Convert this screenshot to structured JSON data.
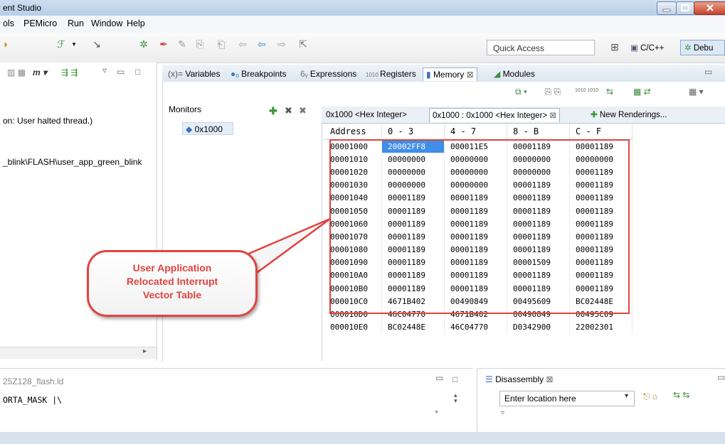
{
  "window": {
    "title": "ent Studio"
  },
  "menu": [
    "ols",
    "PEMicro",
    "Run",
    "Window",
    "Help"
  ],
  "toolbar": {
    "quick_access": "Quick Access",
    "perspective_cc": "C/C++",
    "perspective_debug": "Debu"
  },
  "left_panel": {
    "line1": "on: User halted thread.)",
    "line2": "_blink\\FLASH\\user_app_green_blink"
  },
  "view_tabs": [
    "Variables",
    "Breakpoints",
    "Expressions",
    "Registers",
    "Memory",
    "Modules"
  ],
  "monitors": {
    "label": "Monitors",
    "item": "0x1000"
  },
  "renderings": {
    "tab1": "0x1000 <Hex Integer>",
    "tab2": "0x1000 : 0x1000 <Hex Integer>",
    "new": "New Renderings..."
  },
  "memory": {
    "headers": [
      "Address",
      "0 - 3",
      "4 - 7",
      "8 - B",
      "C - F"
    ],
    "rows": [
      [
        "00001000",
        "20002FF8",
        "000011E5",
        "00001189",
        "00001189"
      ],
      [
        "00001010",
        "00000000",
        "00000000",
        "00000000",
        "00000000"
      ],
      [
        "00001020",
        "00000000",
        "00000000",
        "00000000",
        "00001189"
      ],
      [
        "00001030",
        "00000000",
        "00000000",
        "00001189",
        "00001189"
      ],
      [
        "00001040",
        "00001189",
        "00001189",
        "00001189",
        "00001189"
      ],
      [
        "00001050",
        "00001189",
        "00001189",
        "00001189",
        "00001189"
      ],
      [
        "00001060",
        "00001189",
        "00001189",
        "00001189",
        "00001189"
      ],
      [
        "00001070",
        "00001189",
        "00001189",
        "00001189",
        "00001189"
      ],
      [
        "00001080",
        "00001189",
        "00001189",
        "00001189",
        "00001189"
      ],
      [
        "00001090",
        "00001189",
        "00001189",
        "00001509",
        "00001189"
      ],
      [
        "000010A0",
        "00001189",
        "00001189",
        "00001189",
        "00001189"
      ],
      [
        "000010B0",
        "00001189",
        "00001189",
        "00001189",
        "00001189"
      ],
      [
        "000010C0",
        "4671B402",
        "00490849",
        "00495609",
        "BC02448E"
      ],
      [
        "000010D0",
        "46C04770",
        "4671B402",
        "00490849",
        "00495C09"
      ],
      [
        "000010E0",
        "BC02448E",
        "46C04770",
        "D0342900",
        "22002301"
      ]
    ]
  },
  "callout": {
    "line1": "User Application",
    "line2": "Relocated Interrupt",
    "line3": "Vector Table"
  },
  "editor": {
    "file": "25Z128_flash.ld",
    "code": "ORTA_MASK |\\"
  },
  "disassembly": {
    "tab": "Disassembly",
    "location_placeholder": "Enter location here"
  }
}
